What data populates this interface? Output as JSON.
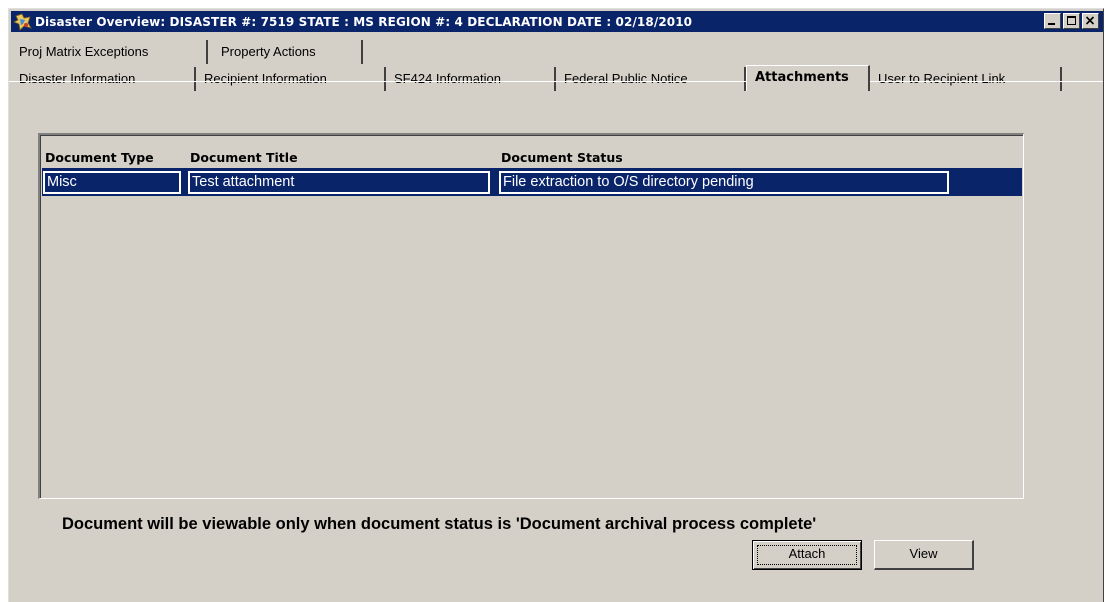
{
  "window": {
    "title": "Disaster Overview:  DISASTER #: 7519   STATE : MS   REGION #: 4   DECLARATION DATE : 02/18/2010"
  },
  "tabs_row1": [
    {
      "label": "Proj Matrix Exceptions"
    },
    {
      "label": "Property Actions"
    }
  ],
  "tabs_row2": [
    {
      "label": "Disaster Information"
    },
    {
      "label": "Recipient  Information"
    },
    {
      "label": "SF424  Information"
    },
    {
      "label": "Federal Public Notice"
    },
    {
      "label": "Attachments",
      "active": true
    },
    {
      "label": "User to Recipient Link"
    }
  ],
  "grid": {
    "columns": [
      "Document Type",
      "Document Title",
      "Document Status"
    ],
    "rows": [
      [
        "Misc",
        "Test attachment",
        "File extraction to O/S directory pending"
      ]
    ]
  },
  "notice": "Document will be viewable only when document status is 'Document archival process complete'",
  "buttons": {
    "attach": "Attach",
    "view": "View"
  },
  "colors": {
    "selection": "#0a246a",
    "face": "#d4d0c8"
  }
}
